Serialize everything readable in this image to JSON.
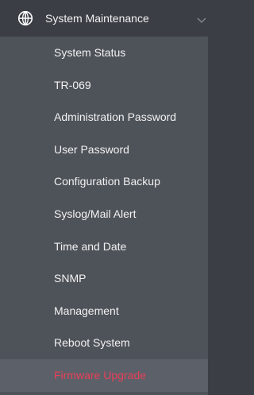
{
  "menu": {
    "section_label": "System Maintenance",
    "section_icon": "globe-icon",
    "expand_icon": "chevron-down-icon",
    "active_color": "#e8405a",
    "items": [
      {
        "label": "System Status"
      },
      {
        "label": "TR-069"
      },
      {
        "label": "Administration Password"
      },
      {
        "label": "User Password"
      },
      {
        "label": "Configuration Backup"
      },
      {
        "label": "Syslog/Mail Alert"
      },
      {
        "label": "Time and Date"
      },
      {
        "label": "SNMP"
      },
      {
        "label": "Management"
      },
      {
        "label": "Reboot System"
      },
      {
        "label": "Firmware Upgrade",
        "active": true
      }
    ]
  }
}
